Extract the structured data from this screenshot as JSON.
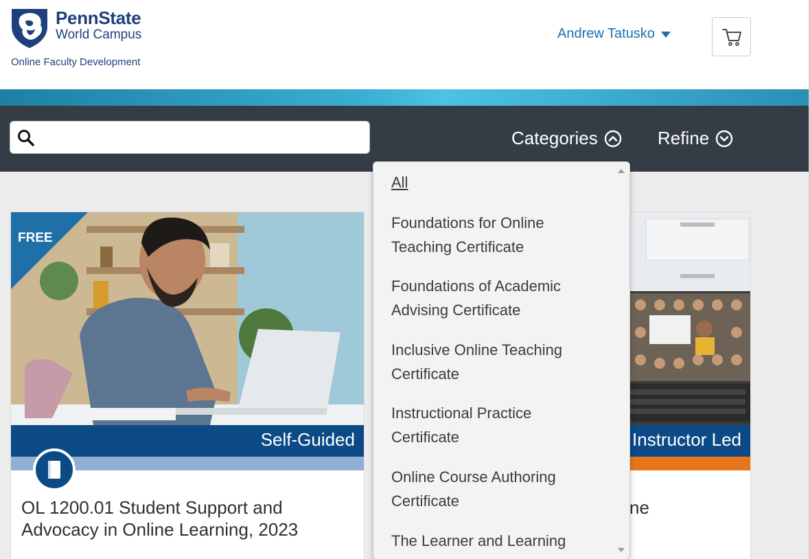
{
  "brand": {
    "name": "PennState",
    "subname": "World Campus",
    "tagline": "Online Faculty Development"
  },
  "header": {
    "user_name": "Andrew Tatusko",
    "cart_icon": "shopping-cart-icon"
  },
  "toolbar": {
    "search_placeholder": "",
    "categories_label": "Categories",
    "refine_label": "Refine"
  },
  "categories_menu": {
    "items": [
      "All",
      "Foundations for Online Teaching Certificate",
      "Foundations of Academic Advising Certificate",
      "Inclusive Online Teaching Certificate",
      "Instructional Practice Certificate",
      "Online Course Authoring Certificate",
      "The Learner and Learning"
    ]
  },
  "cards": [
    {
      "ribbon": "FREE",
      "format": "Self-Guided",
      "title": "OL 1200.01 Student Support and Advocacy in Online Learning, 2023",
      "icon": "book-icon"
    },
    {
      "format": "Instructor Led",
      "title_fragment": "nline"
    }
  ],
  "colors": {
    "brand_blue": "#1e407c",
    "toolbar_bg": "#343d46",
    "banner_blue": "#0c4a86",
    "self_guided_strip": "#8fb0d3",
    "instructor_strip": "#e8751a"
  }
}
